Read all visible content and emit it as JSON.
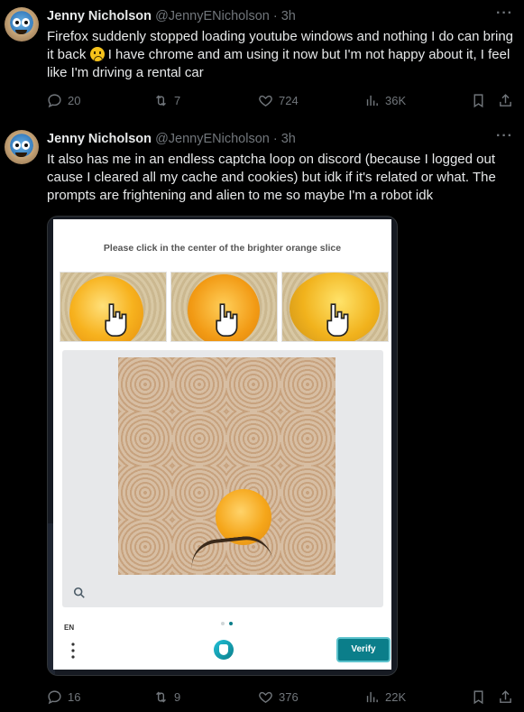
{
  "tweets": [
    {
      "name": "Jenny Nicholson",
      "handle": "@JennyENicholson",
      "separator": "·",
      "time": "3h",
      "text_part1": "Firefox suddenly stopped loading youtube windows and nothing I do can bring it back",
      "text_part2": "I have chrome and am using it now but I'm not happy about it, I feel like I'm driving a rental car",
      "replies": "20",
      "reposts": "7",
      "likes": "724",
      "views": "36K"
    },
    {
      "name": "Jenny Nicholson",
      "handle": "@JennyENicholson",
      "separator": "·",
      "time": "3h",
      "text": "It also has me in an endless captcha loop on discord (because I logged out cause I cleared all my cache and cookies) but idk if it's related or what. The prompts are frightening and alien to me so maybe I'm a robot idk",
      "replies": "16",
      "reposts": "9",
      "likes": "376",
      "views": "22K"
    }
  ],
  "captcha": {
    "prompt": "Please click in the center of the brighter orange slice",
    "language": "EN",
    "verify_label": "Verify",
    "accent_color": "#0b7e8a"
  },
  "more_glyph": "···"
}
